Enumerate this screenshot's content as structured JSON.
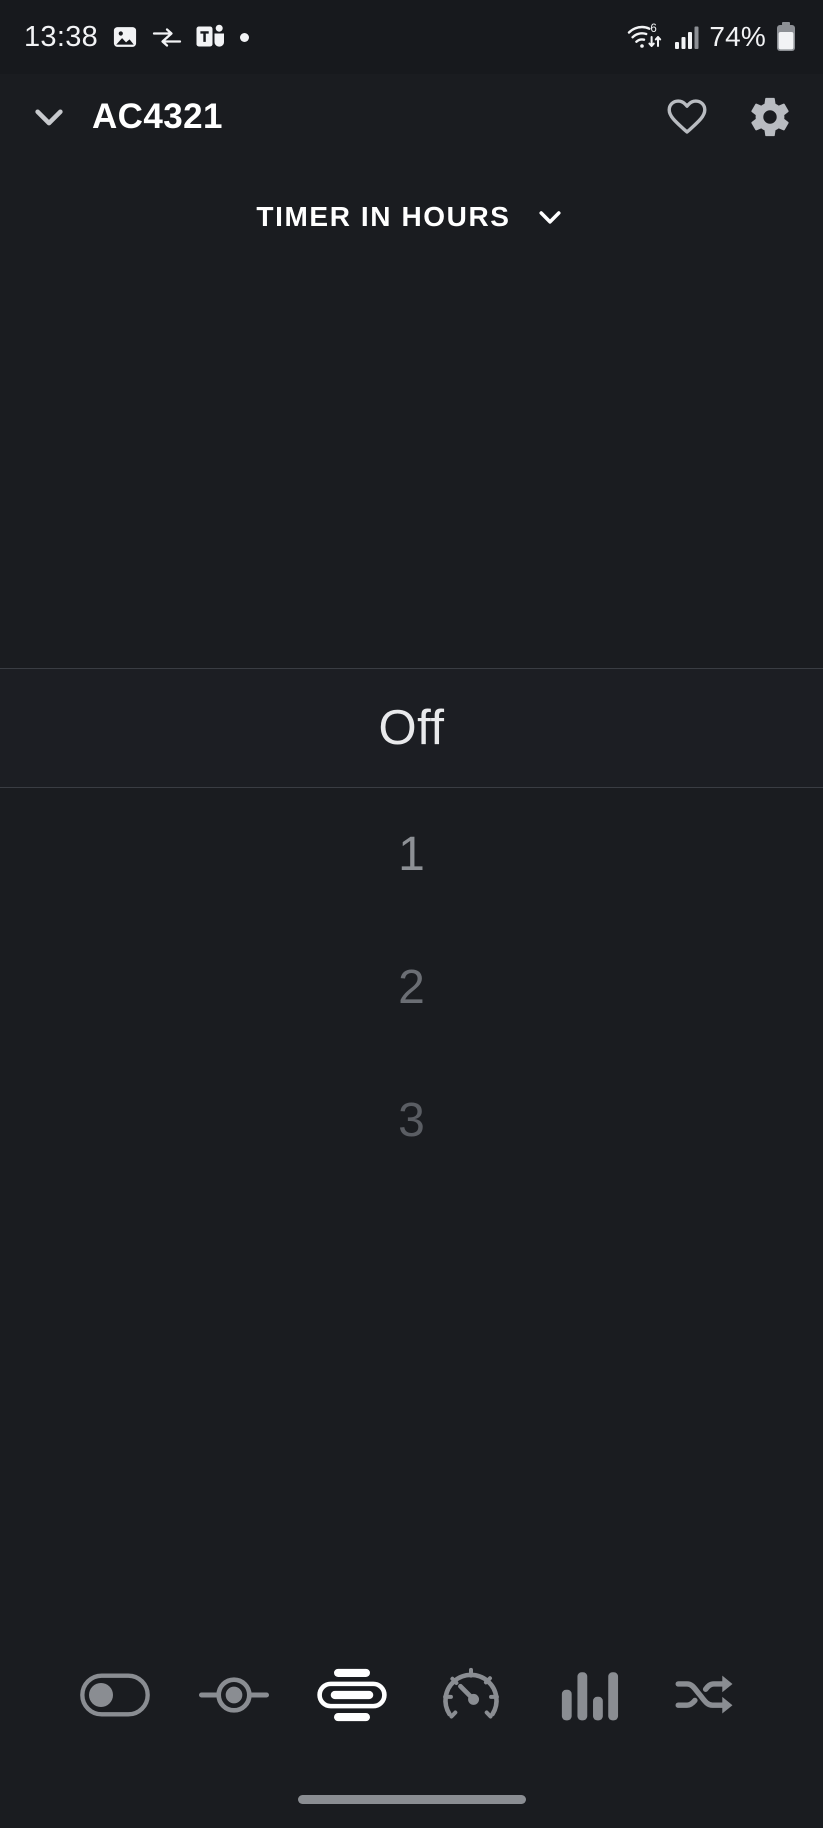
{
  "status_bar": {
    "time": "13:38",
    "battery_text": "74%",
    "icons": [
      {
        "name": "image-icon"
      },
      {
        "name": "transfer-arrows-icon"
      },
      {
        "name": "microsoft-teams-icon"
      },
      {
        "name": "notification-dot-icon"
      }
    ],
    "right_icons": [
      {
        "name": "wifi-6-icon",
        "label": "6"
      },
      {
        "name": "cellular-signal-icon"
      },
      {
        "name": "battery-icon"
      }
    ]
  },
  "app_bar": {
    "collapse_icon": "chevron-down-icon",
    "title": "AC4321",
    "favorite_icon": "heart-icon",
    "settings_icon": "gear-icon"
  },
  "section": {
    "title": "TIMER IN HOURS",
    "dropdown_icon": "chevron-down-icon"
  },
  "picker": {
    "selected_value": "Off",
    "options": [
      {
        "label": "Off",
        "selected": true
      },
      {
        "label": "1",
        "selected": false
      },
      {
        "label": "2",
        "selected": false
      },
      {
        "label": "3",
        "selected": false
      }
    ]
  },
  "toolbar": {
    "items": [
      {
        "name": "power-toggle-icon",
        "active": false
      },
      {
        "name": "slider-control-icon",
        "active": false
      },
      {
        "name": "airflow-icon",
        "active": true
      },
      {
        "name": "gauge-icon",
        "active": false
      },
      {
        "name": "bar-chart-icon",
        "active": false
      },
      {
        "name": "shuffle-icon",
        "active": false
      }
    ]
  },
  "colors": {
    "background": "#1a1c20",
    "status_bar_bg": "#17191d",
    "text_primary": "#ffffff",
    "icon_inactive": "#8a8d92",
    "icon_active": "#ffffff",
    "divider": "#3a3d43"
  },
  "home_indicator": "home-bar"
}
